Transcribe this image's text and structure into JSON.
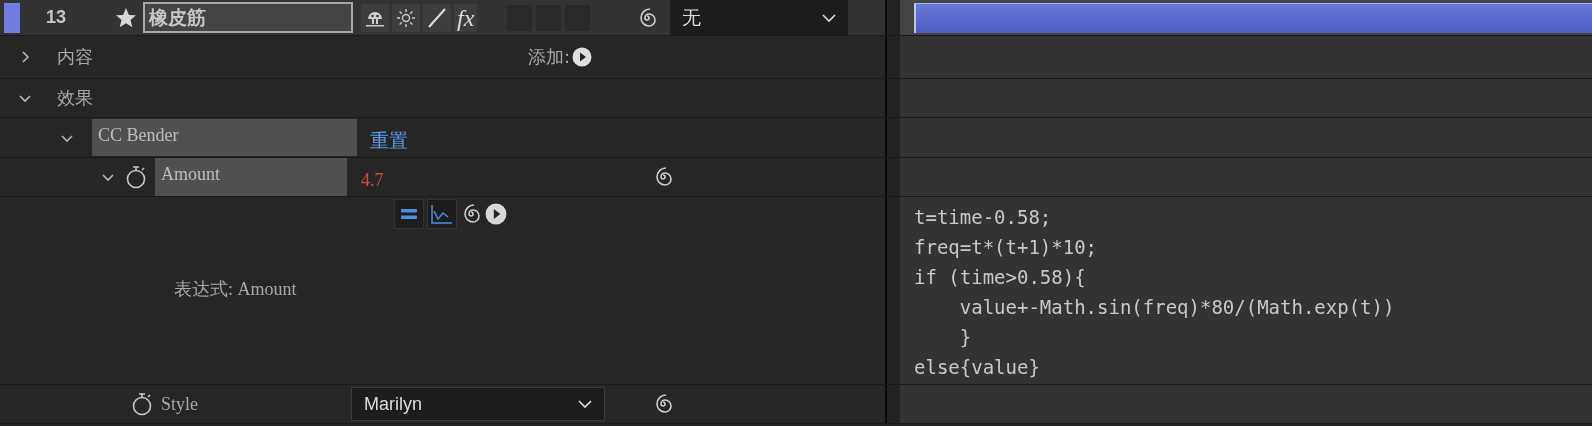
{
  "layer": {
    "number": "13",
    "name": "橡皮筋",
    "fx_label": "fx",
    "fx_on": true,
    "parent": "无"
  },
  "groups": [
    {
      "label": "内容",
      "expanded": false,
      "add_label": "添加:"
    },
    {
      "label": "效果",
      "expanded": true
    }
  ],
  "effect": {
    "name": "CC Bender",
    "expanded": true,
    "reset": "重置"
  },
  "properties": [
    {
      "kind": "value",
      "name": "Amount",
      "expanded": true,
      "value": "4.7",
      "expression_label": "表达式: Amount",
      "expression": [
        "t=time-0.58;",
        "freq=t*(t+1)*10;",
        "if (time>0.58){",
        "    value+-Math.sin(freq)*80/(Math.exp(t))",
        "    }",
        "else{value}"
      ]
    },
    {
      "kind": "dropdown",
      "name": "Style",
      "value": "Marilyn"
    }
  ]
}
